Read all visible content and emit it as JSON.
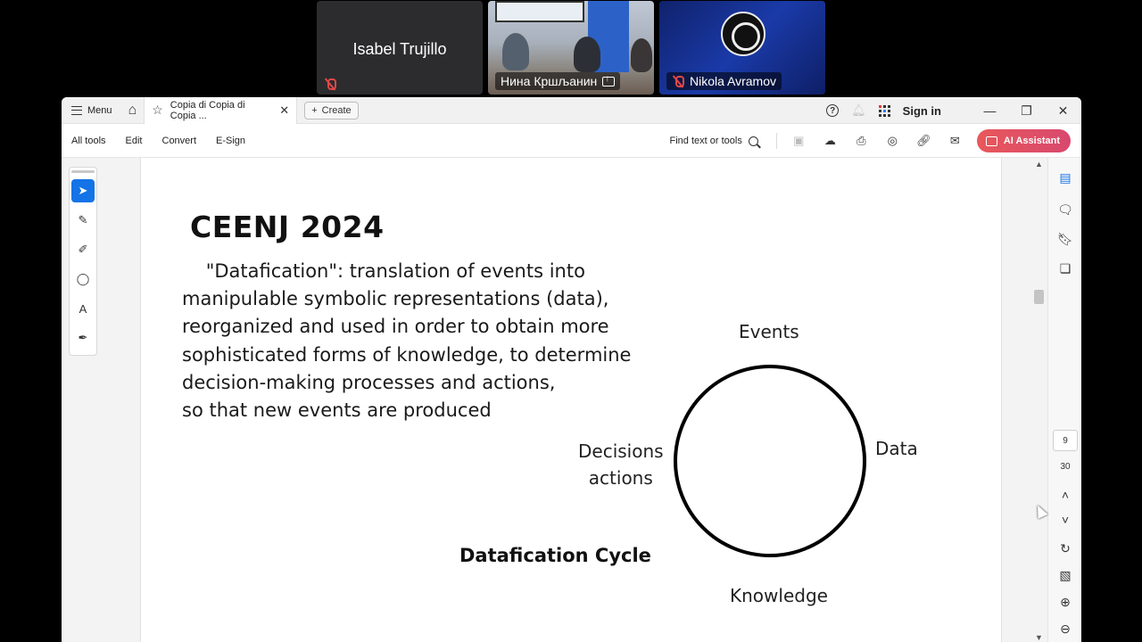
{
  "meeting": {
    "participants": [
      {
        "name": "Isabel Trujillo"
      },
      {
        "name": "Нина Кршљанин"
      },
      {
        "name": "Nikola Avramov"
      }
    ]
  },
  "window": {
    "menu_label": "Menu",
    "tab_title": "Copia di Copia di Copia ...",
    "create_label": "Create",
    "help_icon": "?",
    "sign_in_label": "Sign in"
  },
  "toolbar": {
    "all_tools": "All tools",
    "edit": "Edit",
    "convert": "Convert",
    "esign": "E-Sign",
    "find_label": "Find text or tools",
    "ai_label": "AI Assistant"
  },
  "slide": {
    "title": "CEENJ 2024",
    "body": "    \"Datafication\": translation of events into\nmanipulable symbolic representations (data),\nreorganized and used in order to obtain more\nsophisticated forms of knowledge, to determine\ndecision-making processes and actions,\nso that new events are produced",
    "cycle_title": "Datafication Cycle",
    "labels": {
      "events": "Events",
      "data": "Data",
      "knowledge": "Knowledge",
      "decisions": "Decisions\nactions"
    }
  },
  "navigation": {
    "current_page": "9",
    "total_pages": "30"
  },
  "colors": {
    "accent": "#1473e6",
    "ai_button": "#e8585b"
  }
}
